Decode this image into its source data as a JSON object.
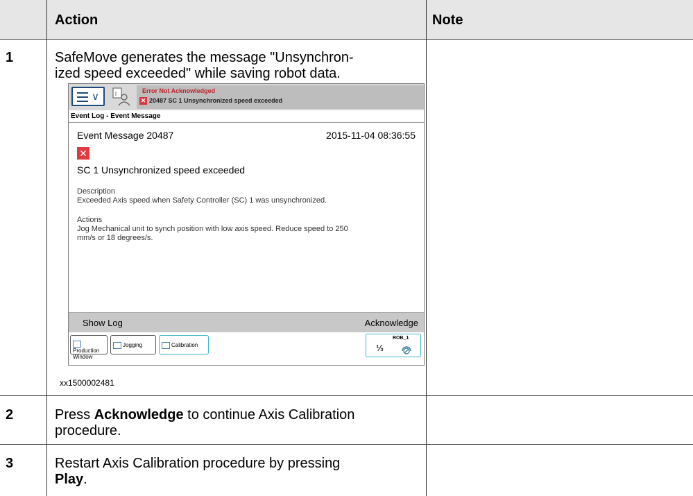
{
  "table": {
    "headers": {
      "step": "",
      "action": "Action",
      "note": "Note"
    },
    "rows": [
      {
        "number": "1",
        "action_text": "SafeMove generates the message \"Unsynchron-ized speed exceeded\" while saving robot data.",
        "action_line1": "SafeMove generates the message \"Unsynchron-",
        "action_line2": "ized speed exceeded\" while saving robot data.",
        "figure_caption": "xx1500002481",
        "note": ""
      },
      {
        "number": "2",
        "prefix": "Press ",
        "bold": "Acknowledge",
        "suffix": " to continue Axis Calibration",
        "line2": "procedure.",
        "note": ""
      },
      {
        "number": "3",
        "line1": "Restart Axis Calibration procedure by pressing",
        "bold": "Play",
        "suffix": ".",
        "note": ""
      }
    ]
  },
  "screenshot": {
    "status_title": "Error Not Acknowledged",
    "status_message": "20487  SC 1 Unsynchronized speed exceeded",
    "breadcrumb": "Event Log - Event Message",
    "event_title": "Event Message 20487",
    "event_timestamp": "2015-11-04 08:36:55",
    "event_headline": "SC 1 Unsynchronized speed exceeded",
    "description_label": "Description",
    "description_text": "Exceeded Axis speed when Safety Controller (SC) 1 was unsynchronized.",
    "actions_label": "Actions",
    "actions_line1": "Jog Mechanical unit to synch position with low axis speed. Reduce speed to 250",
    "actions_line2": "mm/s or 18 degrees/s.",
    "show_log_label": "Show Log",
    "acknowledge_label": "Acknowledge",
    "taskbar": {
      "production_line1": "Production",
      "production_line2": "Window",
      "jogging": "Jogging",
      "calibration": "Calibration",
      "robot_name": "ROB_1",
      "robot_fraction": "⅓"
    },
    "icons": {
      "menu": "hamburger-menu-icon",
      "status": "person-info-icon",
      "error": "error-x-icon",
      "speed": "speed-dial-icon"
    },
    "colors": {
      "error_red": "#e0393f",
      "accent_blue": "#1c4a7a",
      "teal_border": "#3cb6c8"
    }
  }
}
